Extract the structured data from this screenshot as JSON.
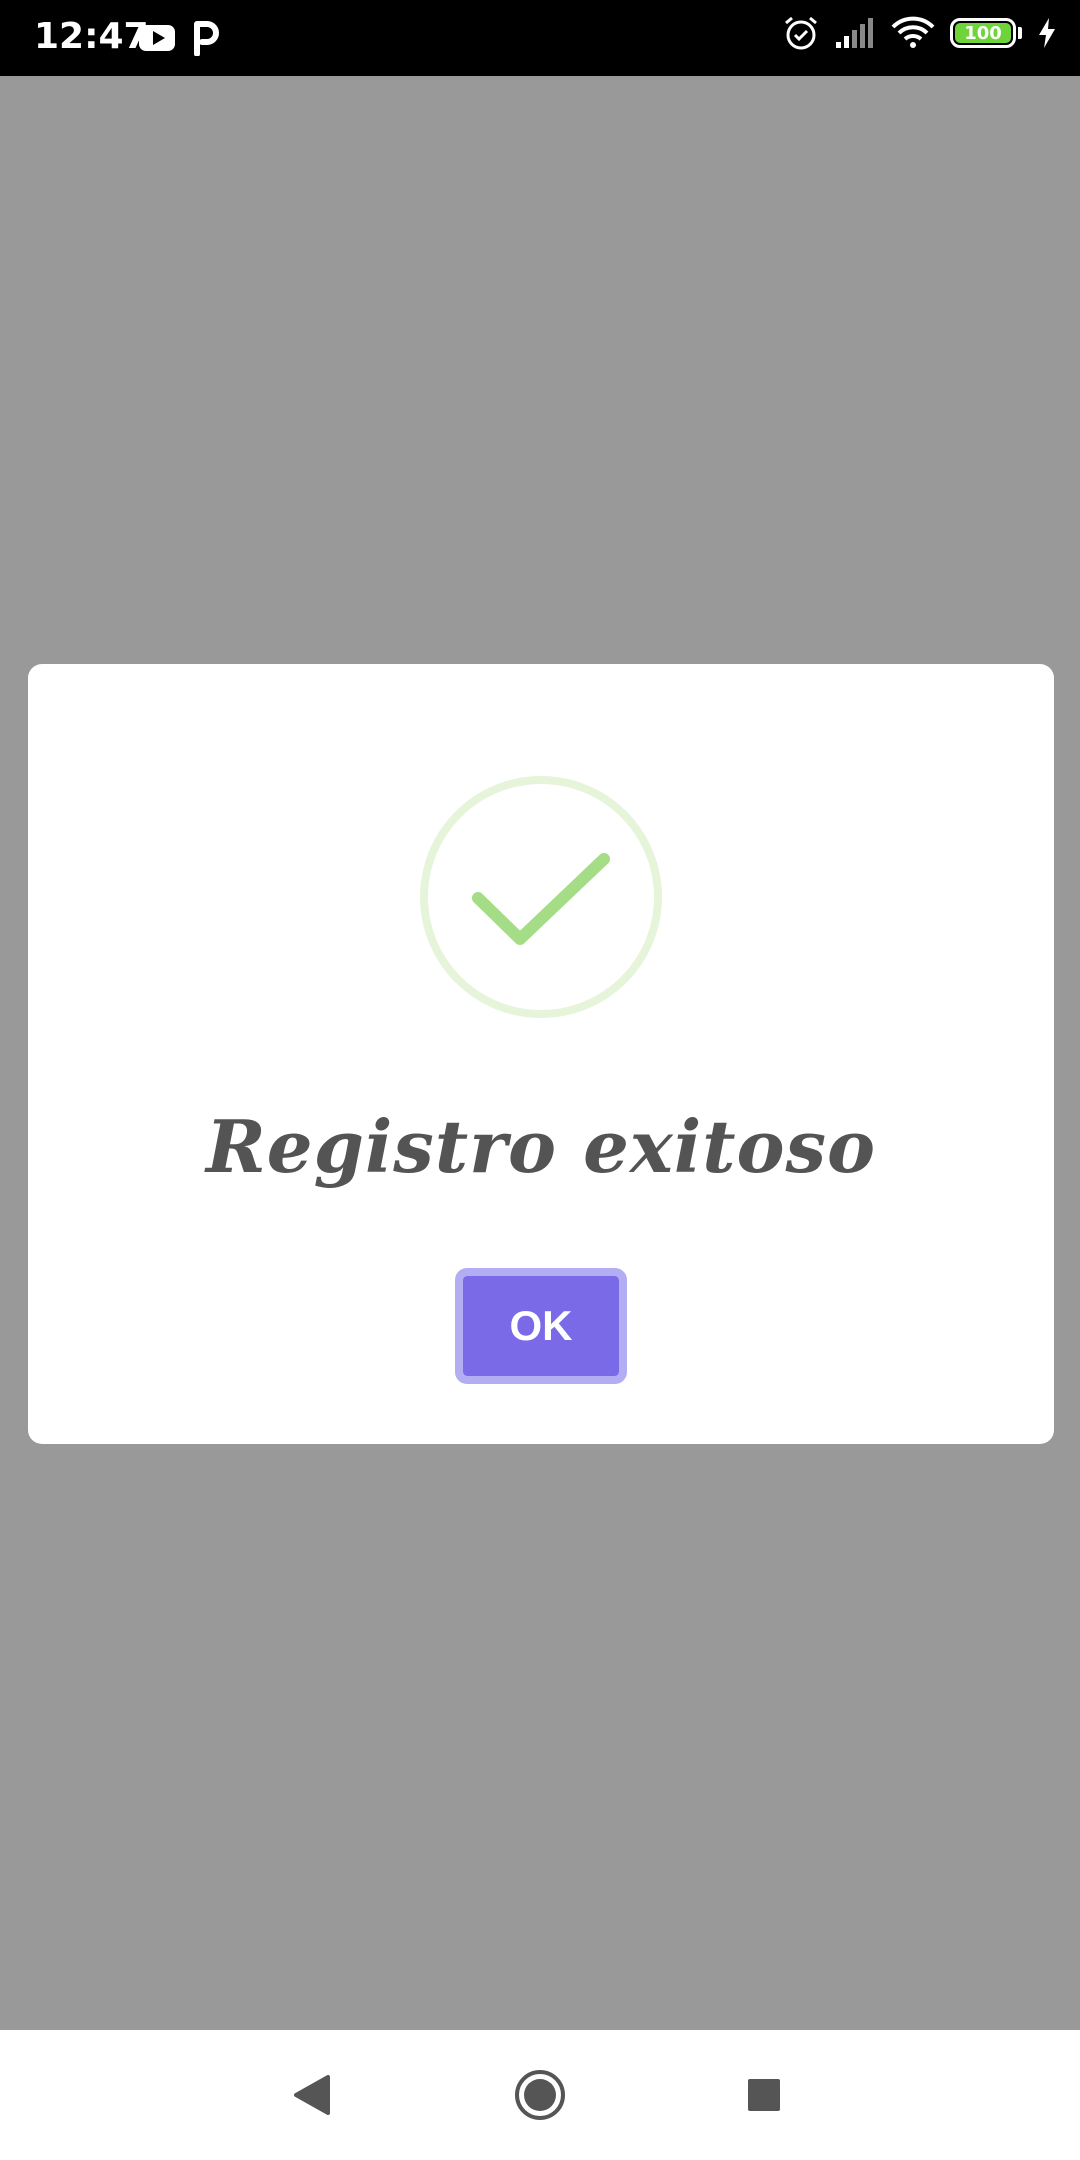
{
  "status_bar": {
    "time": "12:47",
    "battery_level": "100",
    "left_icons": [
      "youtube-icon",
      "parking-icon"
    ],
    "right_icons": [
      "alarm-icon",
      "cell-signal-icon",
      "wifi-icon",
      "battery-icon",
      "charging-bolt-icon"
    ]
  },
  "dialog": {
    "icon": "checkmark-circle-icon",
    "title": "Registro exitoso",
    "ok_label": "OK"
  },
  "nav_bar": {
    "items": [
      "back-icon",
      "home-icon",
      "recents-icon"
    ]
  },
  "colors": {
    "backdrop": "#999999",
    "dialog_bg": "#ffffff",
    "check_green": "#a5dc86",
    "check_ring": "#e6f4da",
    "title_text": "#545454",
    "ok_button": "#7b6ae8",
    "ok_button_border": "#b3aef3"
  }
}
